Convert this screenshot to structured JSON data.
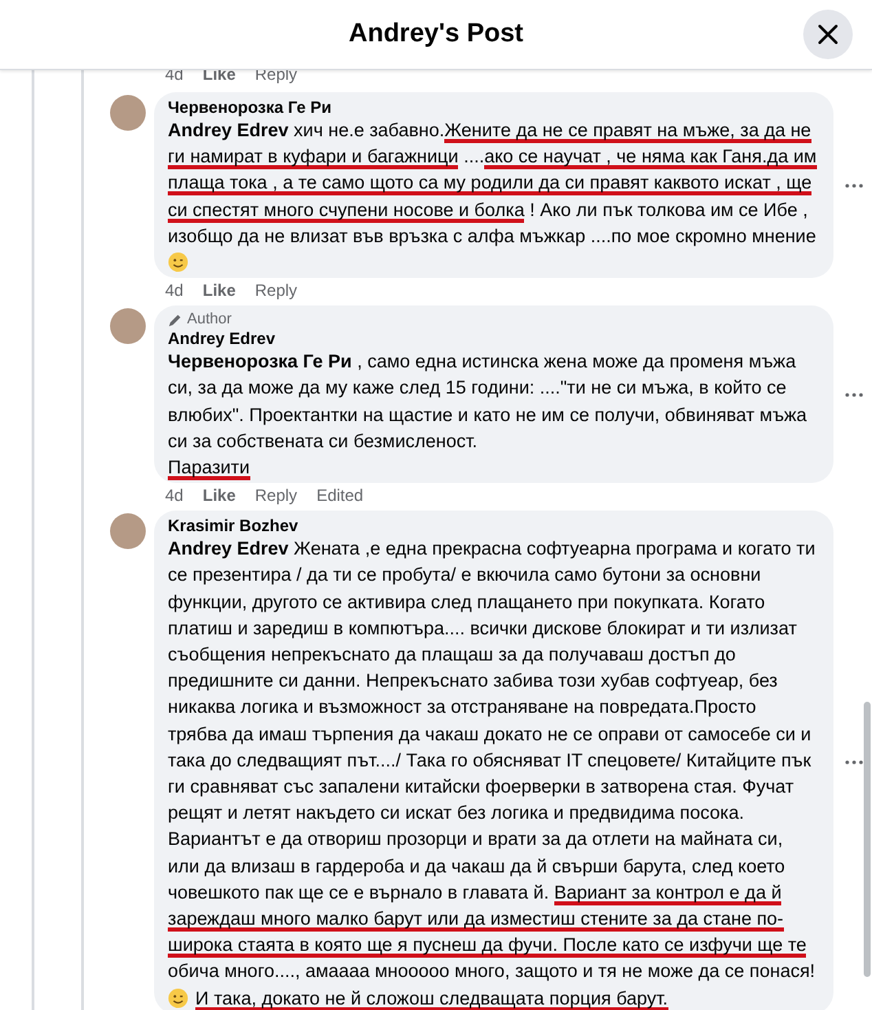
{
  "window": {
    "title": "Andrey's Post"
  },
  "previous_comment_actions": {
    "time": "4d",
    "like": "Like",
    "reply": "Reply"
  },
  "comments": [
    {
      "author": "Червенорозка Ге Ри",
      "body": [
        {
          "kind": "text",
          "text": "**Andrey Edrev** хич не.е забавно.",
          "marked": false
        },
        {
          "kind": "text",
          "text": "Жените да не се правят на мъже, за да не ги намират в куфари и багажници",
          "marked": true
        },
        {
          "kind": "text",
          "text": " ....",
          "marked": false
        },
        {
          "kind": "text",
          "text": "ако се научат , че няма как Ганя.да им плаща тока , а те само щото са му родили да си правят каквото искат , ще си спестят много счупени носове и болка",
          "marked": true
        },
        {
          "kind": "text",
          "text": " ! Ако ли пък толкова им се Ибе , изобщо да не влизат във връзка с алфа мъжкар ....по мое скромно мнение ",
          "marked": false
        },
        {
          "kind": "emoji"
        }
      ],
      "time": "4d",
      "like": "Like",
      "reply": "Reply"
    },
    {
      "author": "Andrey Edrev",
      "badge": "Author",
      "body": [
        {
          "kind": "text",
          "text": "**Червенорозка Ге Ри** , само една истинска жена може да променя мъжа си, за да може да му каже след 15 години: ....\"ти не си мъжа, в който се влюбих\". Проектантки на щастие и като не им се получи, обвиняват мъжа си за собствената си безмисленост.\n",
          "marked": false
        },
        {
          "kind": "text",
          "text": "Паразити",
          "marked": true
        }
      ],
      "time": "4d",
      "like": "Like",
      "reply": "Reply",
      "edited": "Edited"
    },
    {
      "author": "Krasimir Bozhev",
      "body": [
        {
          "kind": "text",
          "text": "**Andrey Edrev** Жената ,е една прекрасна софтуеарна програма и когато ти се презентира / да ти се пробута/ е вкючила само бутони за основни функции, другото се активира след плащането при покупката. Когато платиш и заредиш в компютъра.... всички дискове блокират и ти излизат съобщения непрекъснато да плащаш за да получаваш достъп до предишните си данни. Непрекъснато забива този хубав софтуеар, без никаква логика и възможност за отстраняване на повредата.Просто трябва да имаш търпения да чакаш докато не се оправи от самосебе си и така до следващият път..../ Така го обясняват IT спецовете/ Китайците пък ги сравняват със запалени китайски фоерверки в затворена стая. Фучат рещят и летят накъдето си искат без логика и предвидима посока. Вариантът е да отвориш прозорци и врати за да отлети на майната си, или да влизаш в гардероба и да чакаш да й свърши барута, след което човешкото пак ще се е върнало в главата й. ",
          "marked": false
        },
        {
          "kind": "text",
          "text": "Вариант за контрол е да й зареждаш много малко барут или да изместиш стените за да стане по-широка стаята в която ще я пуснеш да фучи. После като се изфучи ще те",
          "marked": true
        },
        {
          "kind": "text",
          "text": " обича много...., амаааа мнооооо много, защото и тя не може да се понася!",
          "marked": false
        },
        {
          "kind": "emoji"
        },
        {
          "kind": "text",
          "text": "И така, докато не й сложош следващата порция барут.",
          "marked": true
        }
      ]
    }
  ]
}
